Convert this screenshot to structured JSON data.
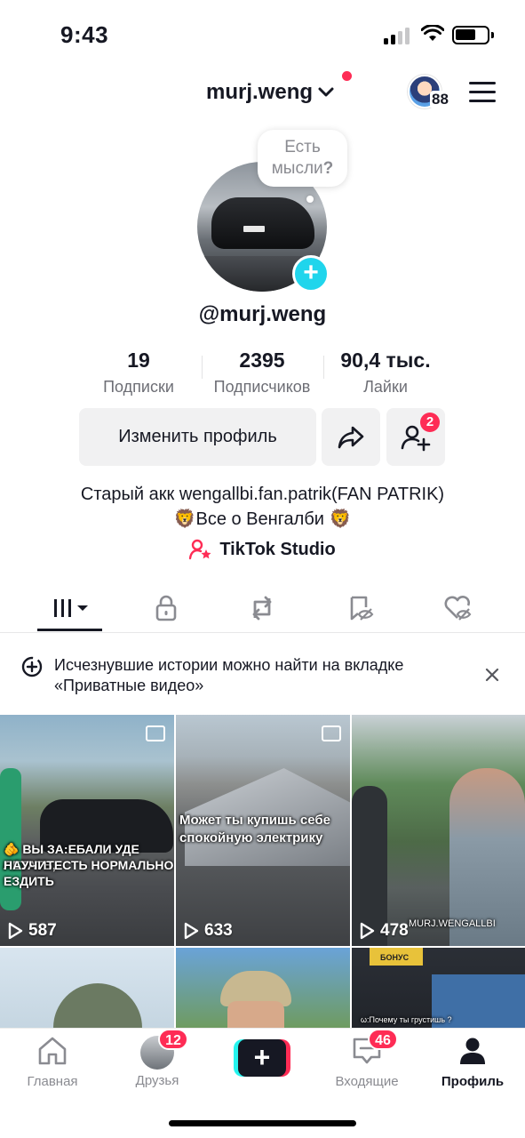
{
  "status_bar": {
    "time": "9:43"
  },
  "header": {
    "username": "murj.weng",
    "avatar_badge": "88"
  },
  "profile": {
    "thought_line1": "Есть",
    "thought_line2": "мысли",
    "thought_q": "?",
    "handle": "@murj.weng"
  },
  "stats": [
    {
      "value": "19",
      "label": "Подписки"
    },
    {
      "value": "2395",
      "label": "Подписчиков"
    },
    {
      "value": "90,4 тыс.",
      "label": "Лайки"
    }
  ],
  "actions": {
    "edit_label": "Изменить профиль",
    "friends_badge": "2"
  },
  "bio": {
    "line1": "Старый акк wengallbi.fan.patrik(FAN PATRIK)",
    "line2": "🦁Все о Венгалби 🦁",
    "studio": "TikTok Studio"
  },
  "notice": {
    "text": "Исчезнувшие истории можно найти на вкладке «Приватные видео»"
  },
  "videos": [
    {
      "views": "587",
      "caption1": "🫵 ВЫ ЗА:ЕБАЛИ УДЕ ЛЕТАТЬ,",
      "caption2": "НАУЧИТЕСТЬ НОРМАЛЬНО ЕЗДИТЬ"
    },
    {
      "views": "633",
      "caption1": "Может ты купишь себе",
      "caption2": "спокойную электрику"
    },
    {
      "views": "478",
      "caption1": "MURJ.WENGALLBI",
      "caption2": ""
    },
    {
      "views": "",
      "caption1": "",
      "caption2": ""
    },
    {
      "views": "",
      "caption1": "",
      "caption2": ""
    },
    {
      "views": "",
      "caption1": "БОНУС",
      "caption2": "ω:Почему ты грустишь ?"
    }
  ],
  "nav": {
    "home": "Главная",
    "friends": "Друзья",
    "friends_badge": "12",
    "inbox": "Входящие",
    "inbox_badge": "46",
    "profile": "Профиль"
  }
}
